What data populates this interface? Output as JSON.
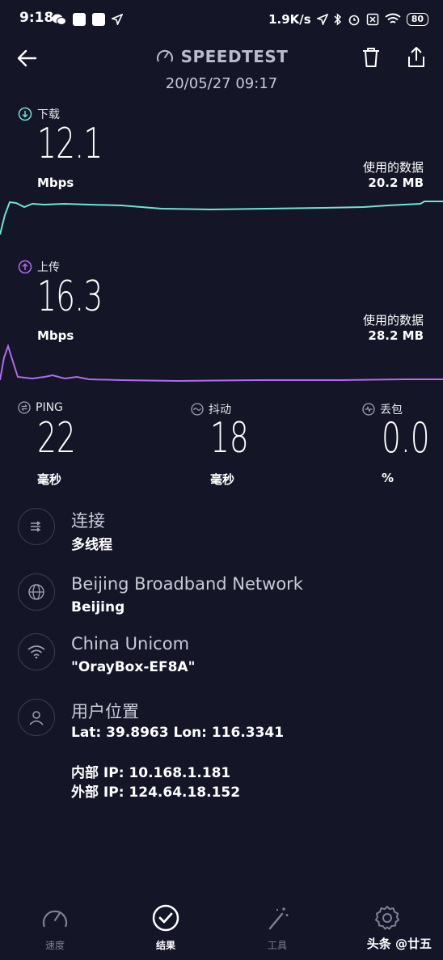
{
  "status_bar": {
    "time": "9:18",
    "network_speed": "1.9K/s",
    "battery": "80"
  },
  "header": {
    "title": "SPEEDTEST",
    "datetime": "20/05/27 09:17"
  },
  "download": {
    "label": "下载",
    "value": "12.1",
    "unit": "Mbps",
    "used_label": "使用的数据",
    "used_value": "20.2 MB",
    "color": "#6fe3d6"
  },
  "upload": {
    "label": "上传",
    "value": "16.3",
    "unit": "Mbps",
    "used_label": "使用的数据",
    "used_value": "28.2 MB",
    "color": "#b06cf0"
  },
  "ping": {
    "label": "PING",
    "value": "22",
    "unit": "毫秒"
  },
  "jitter": {
    "label": "抖动",
    "value": "18",
    "unit": "毫秒"
  },
  "loss": {
    "label": "丢包",
    "value": "0.0",
    "unit": "%"
  },
  "info": {
    "connection": {
      "title": "连接",
      "sub": "多线程"
    },
    "provider": {
      "title": "Beijing Broadband Network",
      "sub": "Beijing"
    },
    "wifi": {
      "title": "China Unicom",
      "sub": "\"OrayBox-EF8A\""
    },
    "location": {
      "title": "用户位置",
      "latlon": "Lat: 39.8963 Lon: 116.3341",
      "internal_ip": "内部 IP: 10.168.1.181",
      "external_ip": "外部 IP: 124.64.18.152"
    }
  },
  "nav": {
    "speed": "速度",
    "results": "结果",
    "tools": "工具",
    "settings": ""
  },
  "watermark": "头条 @廿五"
}
